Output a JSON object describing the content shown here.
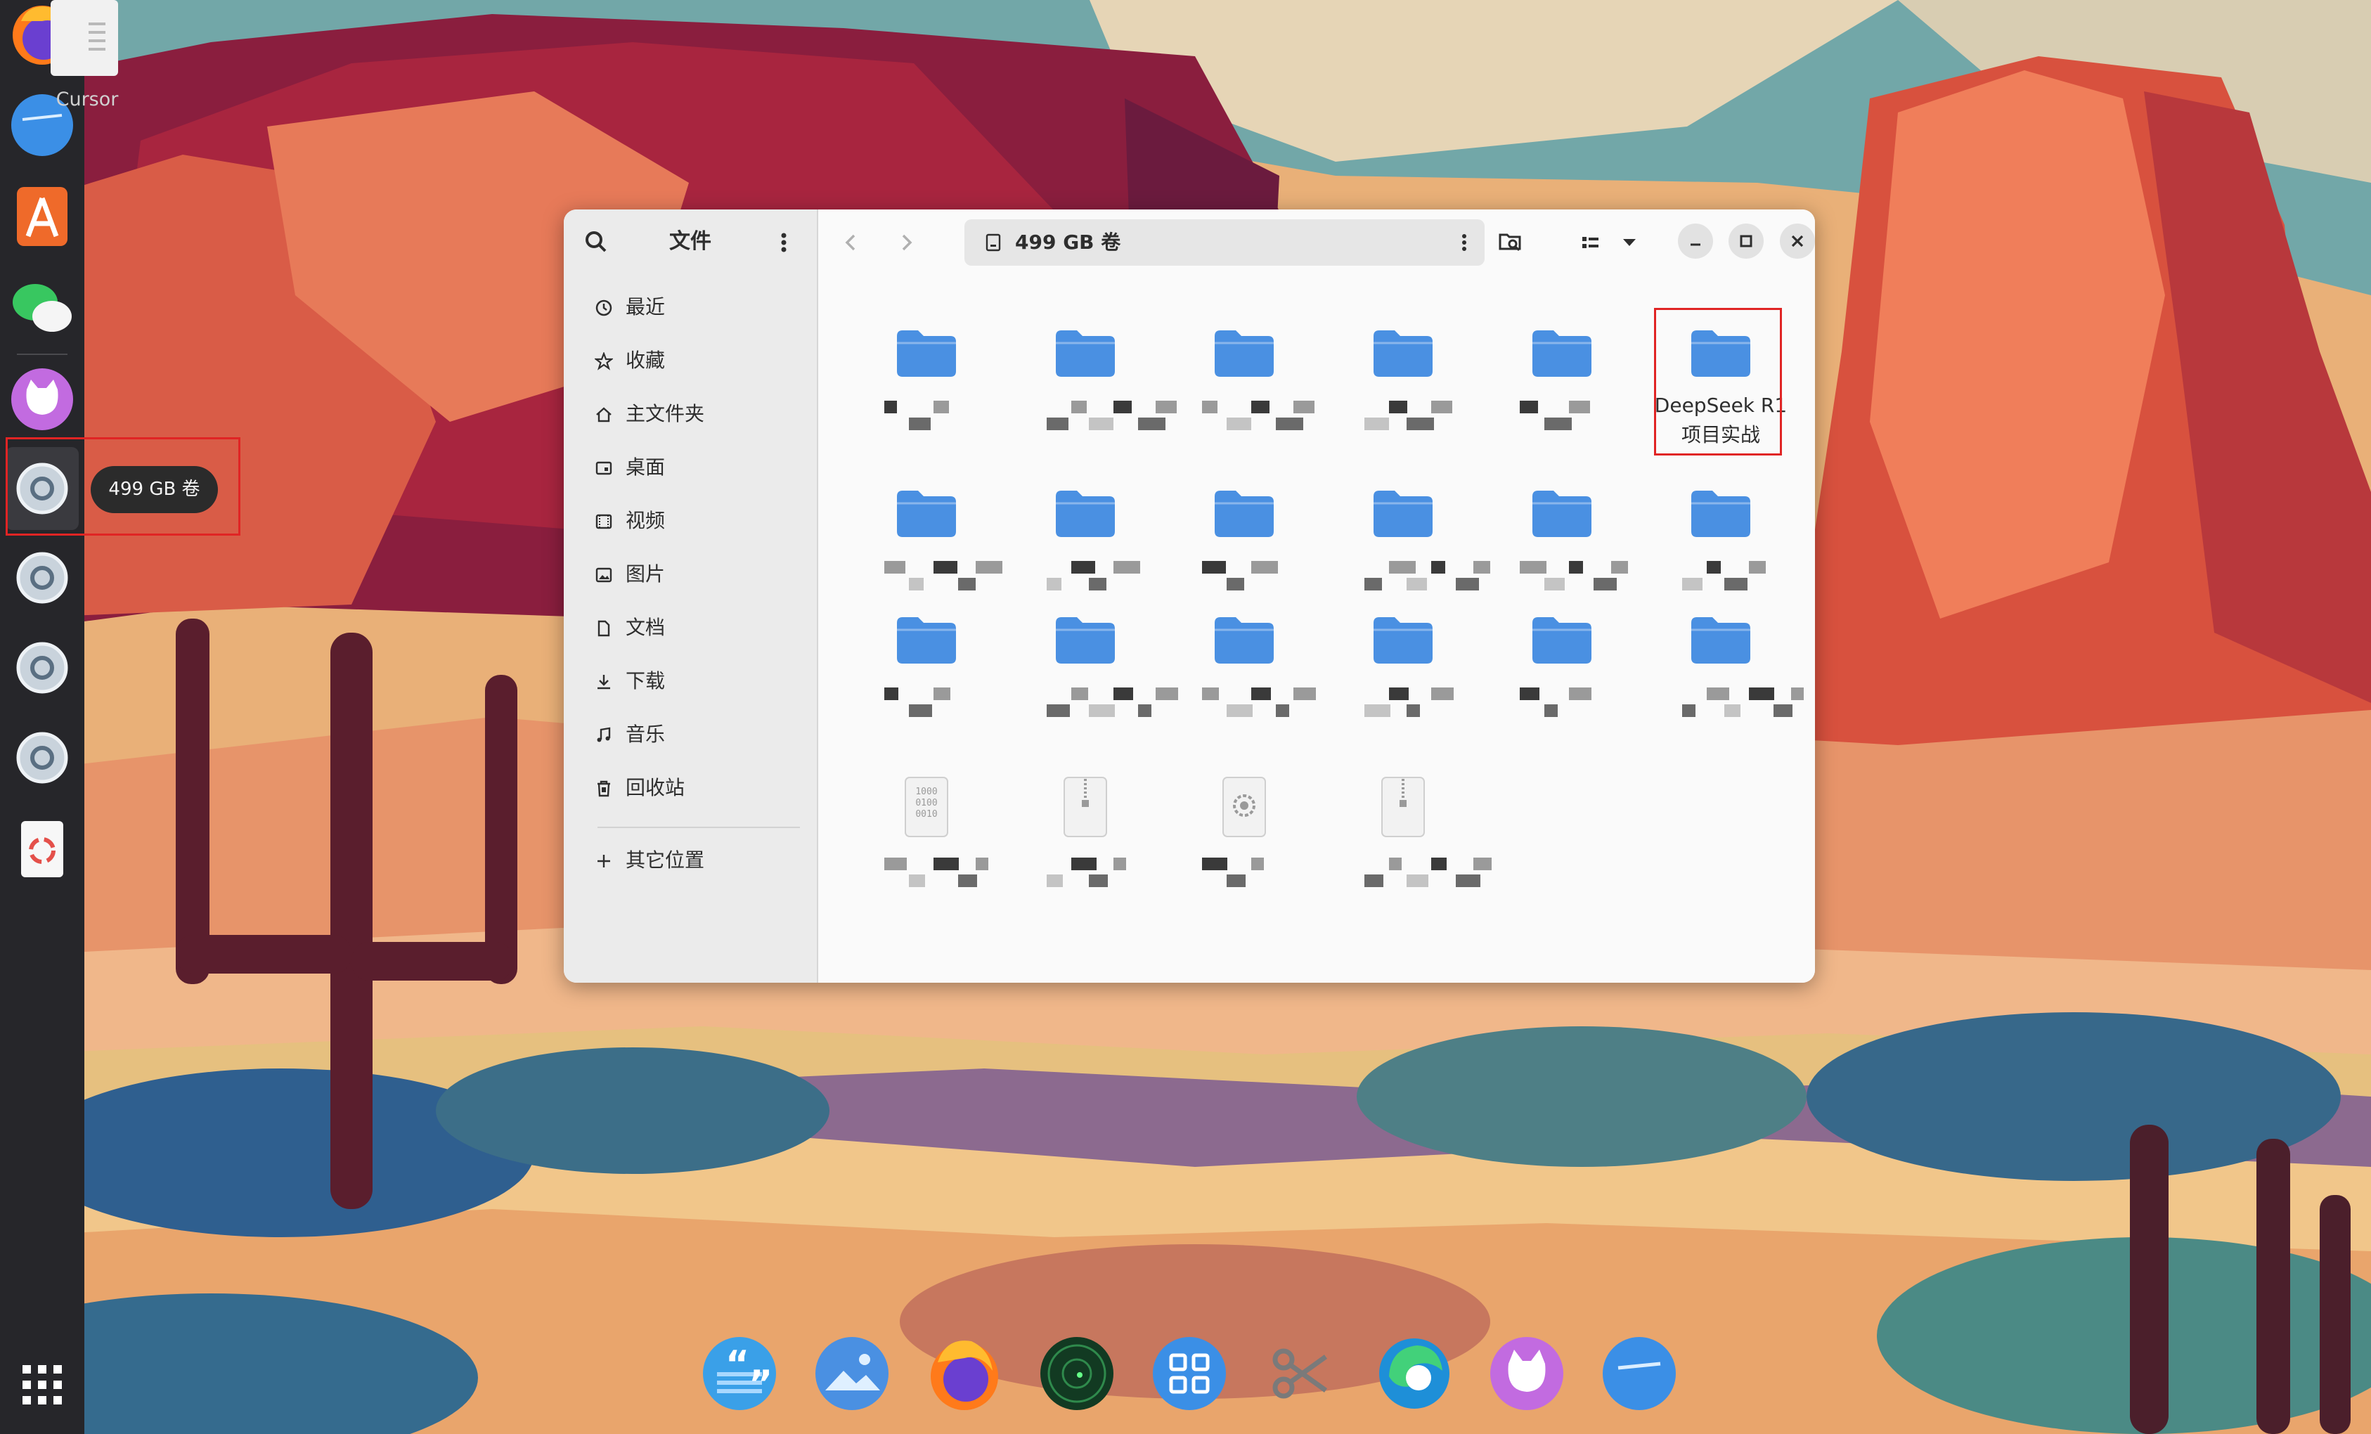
{
  "desktop": {
    "file_label": "Cursor"
  },
  "left_dock": {
    "items": [
      {
        "name": "firefox-icon"
      },
      {
        "name": "files-icon"
      },
      {
        "name": "app-store-icon"
      },
      {
        "name": "wechat-icon"
      },
      {
        "name": "cat-app-icon"
      },
      {
        "name": "drive-icon"
      },
      {
        "name": "drive-icon"
      },
      {
        "name": "drive-icon"
      },
      {
        "name": "drive-icon"
      },
      {
        "name": "trash-icon"
      },
      {
        "name": "app-grid-icon"
      }
    ],
    "tooltip": "499 GB 卷"
  },
  "file_manager": {
    "sidebar": {
      "title": "文件",
      "items": [
        {
          "label": "最近",
          "icon": "clock-icon"
        },
        {
          "label": "收藏",
          "icon": "star-icon"
        },
        {
          "label": "主文件夹",
          "icon": "home-icon"
        },
        {
          "label": "桌面",
          "icon": "desktop-icon"
        },
        {
          "label": "视频",
          "icon": "video-icon"
        },
        {
          "label": "图片",
          "icon": "image-icon"
        },
        {
          "label": "文档",
          "icon": "document-icon"
        },
        {
          "label": "下载",
          "icon": "download-icon"
        },
        {
          "label": "音乐",
          "icon": "music-icon"
        },
        {
          "label": "回收站",
          "icon": "trash-icon"
        }
      ],
      "other_locations": "其它位置"
    },
    "header": {
      "location": "499 GB 卷"
    },
    "files": [
      {
        "type": "folder",
        "name": ""
      },
      {
        "type": "folder",
        "name": ""
      },
      {
        "type": "folder",
        "name": ""
      },
      {
        "type": "folder",
        "name": ""
      },
      {
        "type": "folder",
        "name": ""
      },
      {
        "type": "folder",
        "name": "DeepSeek R1 项目实战",
        "highlighted": true
      },
      {
        "type": "folder",
        "name": ""
      },
      {
        "type": "folder",
        "name": ""
      },
      {
        "type": "folder",
        "name": ""
      },
      {
        "type": "folder",
        "name": ""
      },
      {
        "type": "folder",
        "name": ""
      },
      {
        "type": "folder",
        "name": ""
      },
      {
        "type": "folder",
        "name": ""
      },
      {
        "type": "folder",
        "name": ""
      },
      {
        "type": "folder",
        "name": ""
      },
      {
        "type": "folder",
        "name": ""
      },
      {
        "type": "folder",
        "name": ""
      },
      {
        "type": "folder",
        "name": ""
      },
      {
        "type": "binary-file",
        "name": ""
      },
      {
        "type": "archive-file",
        "name": ""
      },
      {
        "type": "settings-file",
        "name": ""
      },
      {
        "type": "archive-file",
        "name": ""
      }
    ],
    "binary_icon_text": [
      "1000",
      "0100",
      "0010"
    ]
  },
  "bottom_dock": {
    "items": [
      {
        "name": "quote-app-icon"
      },
      {
        "name": "image-viewer-icon"
      },
      {
        "name": "firefox-icon"
      },
      {
        "name": "radar-app-icon"
      },
      {
        "name": "app-center-icon"
      },
      {
        "name": "scissors-icon"
      },
      {
        "name": "edge-browser-icon"
      },
      {
        "name": "cat-app-icon"
      },
      {
        "name": "files-icon"
      }
    ]
  },
  "colors": {
    "folder_blue": "#4a90e2",
    "dock_bg": "#26262a",
    "highlight_red": "#e02424"
  }
}
